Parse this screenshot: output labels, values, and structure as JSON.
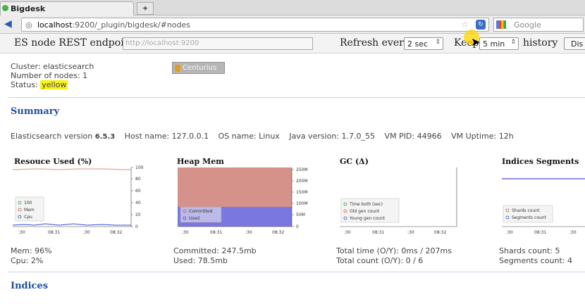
{
  "browser": {
    "tab_title": "Bigdesk",
    "new_tab_icon": "plus-icon",
    "url_host": "localhost",
    "url_rest": ":9200/_plugin/bigdesk/#nodes",
    "search_placeholder": "Google"
  },
  "header": {
    "endpoint_label": "ES node REST endpoint",
    "endpoint_placeholder": "http://localhost:9200",
    "refresh_label": "Refresh every",
    "refresh_value": "2 sec",
    "keep_label": "Keep",
    "keep_value": "5 min",
    "history_label": "history",
    "dis_button": "Dis"
  },
  "cluster": {
    "cluster_line": "Cluster: elasticsearch",
    "nodes_line": "Number of nodes: 1",
    "status_label": "Status:",
    "status_value": "yellow",
    "status_color": "#f7f21a",
    "node_name": "Centurius"
  },
  "summary": {
    "title": "Summary",
    "es_version_label": "Elasticsearch version",
    "es_version": "6.5.3",
    "host_name": "Host name: 127.0.0.1",
    "os_name": "OS name: Linux",
    "java_version": "Java version: 1.7.0_55",
    "vm_pid": "VM PID: 44966",
    "vm_uptime": "VM Uptime: 12h"
  },
  "charts": {
    "resources": {
      "title": "Resouce Used (%)",
      "y_ticks": [
        "100",
        "80",
        "60",
        "40",
        "20",
        "0"
      ],
      "x_ticks": [
        ":30",
        "08:31",
        ":30",
        "08:32"
      ],
      "legend": [
        "100",
        "Mem",
        "Cpu"
      ]
    },
    "heap": {
      "title": "Heap Mem",
      "y_ticks": [
        "250M",
        "200M",
        "150M",
        "100M",
        "50M",
        "0"
      ],
      "x_ticks": [
        ":30",
        "08:31",
        ":30",
        "08:32"
      ],
      "legend": [
        "Committed",
        "Used"
      ]
    },
    "gc": {
      "title": "GC (Δ)",
      "x_ticks": [
        ":30",
        "08:31",
        ":30",
        "08:32"
      ],
      "legend": [
        "Time both (sec)",
        "Old gen count",
        "Young gen count"
      ]
    },
    "segments": {
      "title": "Indices Segments",
      "x_ticks": [
        ":30",
        "08:31",
        ":30"
      ],
      "legend": [
        "Shards count",
        "Segments count"
      ]
    }
  },
  "stats": {
    "mem": "Mem: 96%",
    "cpu": "Cpu: 2%",
    "committed": "Committed: 247.5mb",
    "used": "Used: 78.5mb",
    "gc_time": "Total time (O/Y): 0ms / 207ms",
    "gc_count": "Total count (O/Y): 0 / 6",
    "shards": "Shards count: 5",
    "segments": "Segments count: 4"
  },
  "indices": {
    "title": "Indices"
  },
  "colors": {
    "mem_line": "#e8b5a6",
    "cpu_line": "#3d4fd0",
    "committed_fill": "#d5928a",
    "used_fill": "#7a78e0",
    "link_blue": "#1f4e9c"
  }
}
